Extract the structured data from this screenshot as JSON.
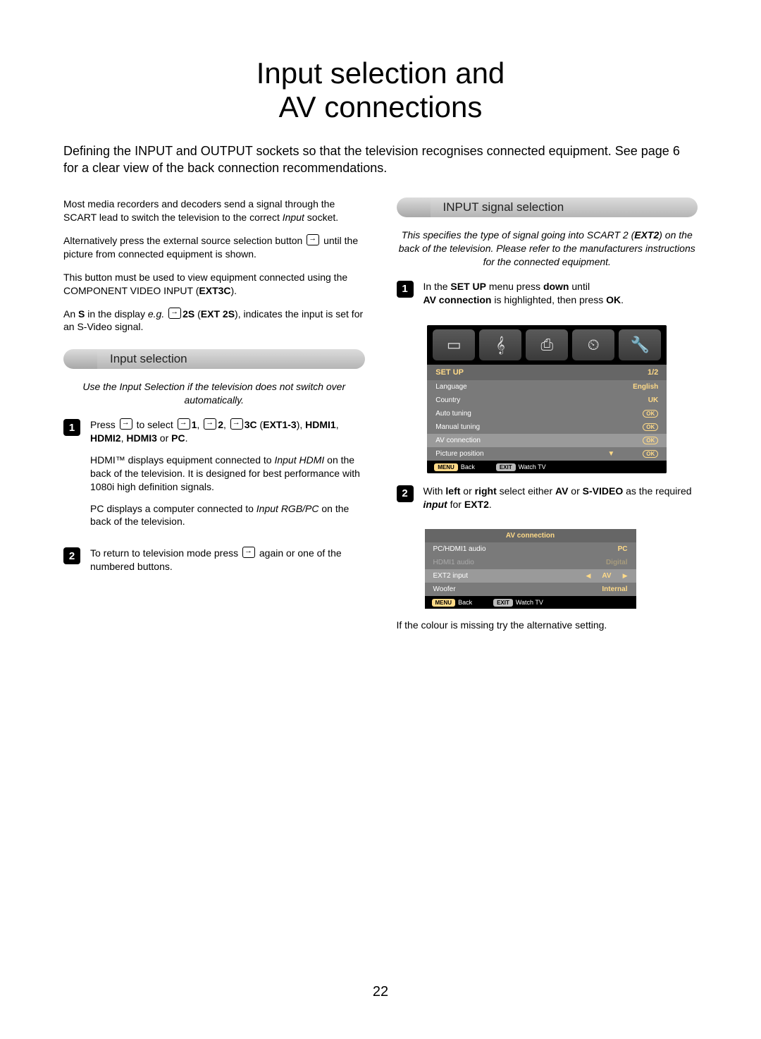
{
  "title_line1": "Input selection and",
  "title_line2": "AV connections",
  "intro": "Defining the INPUT and OUTPUT sockets so that the television recognises connected equipment. See page 6 for a clear view of the back connection recommendations.",
  "left": {
    "p1_a": "Most media recorders and decoders send a signal through the SCART lead to switch the television to the correct ",
    "p1_b": "Input",
    "p1_c": " socket.",
    "p2_a": "Alternatively press the external source selection button ",
    "p2_b": " until the picture from connected equipment is shown.",
    "p3_a": "This button must be used to view equipment connected using the COMPONENT VIDEO INPUT (",
    "p3_b": "EXT3C",
    "p3_c": ").",
    "p4_a": "An ",
    "p4_b": "S",
    "p4_c": " in the display ",
    "p4_d": "e.g.",
    "p4_e": "2S",
    "p4_f": " (",
    "p4_g": "EXT 2S",
    "p4_h": "), indicates the input is set for an S-Video signal.",
    "section": "Input selection",
    "intro_step": "Use the Input Selection if the television does not switch over automatically.",
    "s1_a": "Press ",
    "s1_b": " to select ",
    "s1_c": "1",
    "s1_d": ", ",
    "s1_e": "2",
    "s1_f": ", ",
    "s1_g": "3C",
    "s1_h": " (",
    "s1_i": "EXT1-3",
    "s1_j": "), ",
    "s1_k": "HDMI1",
    "s1_l": ", ",
    "s1_m": "HDMI2",
    "s1_n": ", ",
    "s1_o": "HDMI3",
    "s1_p": " or ",
    "s1_q": "PC",
    "s1_r": ".",
    "s1_p2_a": "HDMI™ displays equipment connected to ",
    "s1_p2_b": "Input HDMI",
    "s1_p2_c": " on the back of the television. It is designed for best performance with 1080i high definition signals.",
    "s1_p3_a": "PC displays a computer connected to ",
    "s1_p3_b": "Input RGB/PC",
    "s1_p3_c": " on the back of the television.",
    "s2_a": "To return to television mode press ",
    "s2_b": " again or one of the numbered buttons."
  },
  "right": {
    "section": "INPUT signal selection",
    "intro_a": "This specifies the type of signal going into SCART 2 (",
    "intro_b": "EXT2",
    "intro_c": ") on the back of the television. Please refer to the manufacturers instructions for the connected equipment.",
    "s1_a": "In the ",
    "s1_b": "SET UP",
    "s1_c": " menu press ",
    "s1_d": "down",
    "s1_e": " until ",
    "s1_f": "AV connection",
    "s1_g": " is highlighted, then press ",
    "s1_h": "OK",
    "s1_i": ".",
    "s2_a": "With ",
    "s2_b": "left",
    "s2_c": " or ",
    "s2_d": "right",
    "s2_e": " select either ",
    "s2_f": "AV",
    "s2_g": " or ",
    "s2_h": "S-VIDEO",
    "s2_i": " as the required ",
    "s2_j": "input",
    "s2_k": " for ",
    "s2_l": "EXT2",
    "s2_m": ".",
    "closing": "If the colour is missing try the alternative setting."
  },
  "menu1": {
    "title": "SET UP",
    "page": "1/2",
    "rows": [
      {
        "label": "Language",
        "value": "English",
        "type": "val"
      },
      {
        "label": "Country",
        "value": "UK",
        "type": "val"
      },
      {
        "label": "Auto tuning",
        "value": "OK",
        "type": "ok"
      },
      {
        "label": "Manual tuning",
        "value": "OK",
        "type": "ok"
      },
      {
        "label": "AV connection",
        "value": "OK",
        "type": "ok",
        "hl": true
      },
      {
        "label": "Picture position",
        "value": "OK",
        "type": "ok_down"
      }
    ],
    "footer_back": "Back",
    "footer_watch": "Watch TV",
    "btn_menu": "MENU",
    "btn_exit": "EXIT"
  },
  "menu2": {
    "title": "AV connection",
    "rows": [
      {
        "label": "PC/HDMI1 audio",
        "value": "PC",
        "dim": false
      },
      {
        "label": "HDMI1 audio",
        "value": "Digital",
        "dim": true
      },
      {
        "label": "EXT2 input",
        "value": "AV",
        "sel": true
      },
      {
        "label": "Woofer",
        "value": "Internal",
        "dim": false
      }
    ],
    "footer_back": "Back",
    "footer_watch": "Watch TV",
    "btn_menu": "MENU",
    "btn_exit": "EXIT"
  },
  "page_number": "22"
}
